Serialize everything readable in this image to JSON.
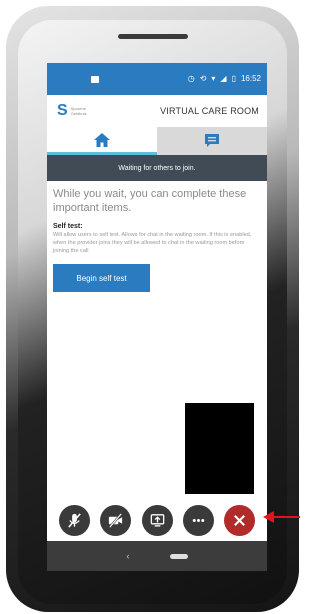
{
  "status_bar": {
    "time": "16:52"
  },
  "header": {
    "logo_letter": "S",
    "logo_text_line1": "Spoorne",
    "logo_text_line2": "Gesthuis",
    "title": "VIRTUAL CARE ROOM"
  },
  "tabs": [
    {
      "name": "home",
      "icon": "home-icon",
      "selected": true
    },
    {
      "name": "chat",
      "icon": "chat-icon",
      "selected": false
    }
  ],
  "banner": {
    "text": "Waiting for others to join."
  },
  "main": {
    "intro": "While you wait, you can complete these important items.",
    "self_test_title": "Self test:",
    "self_test_desc": "Will allow users to self test. Allows for chat in the waiting room. If this is enabled, when the provider joins they will be allowed to chat in the waiting room before joining the call",
    "begin_button": "Begin self test"
  },
  "controls": [
    {
      "name": "mute-mic",
      "icon": "microphone-off-icon"
    },
    {
      "name": "camera-off",
      "icon": "camera-off-icon"
    },
    {
      "name": "share-screen",
      "icon": "share-screen-icon"
    },
    {
      "name": "more",
      "icon": "more-icon"
    },
    {
      "name": "hang-up",
      "icon": "close-icon"
    }
  ],
  "nav": {
    "back": "‹"
  },
  "colors": {
    "brand_blue": "#2a7bc0",
    "banner_dark": "#414b55",
    "hangup_red": "#b22a2a",
    "annotation_arrow": "#e0141e"
  }
}
